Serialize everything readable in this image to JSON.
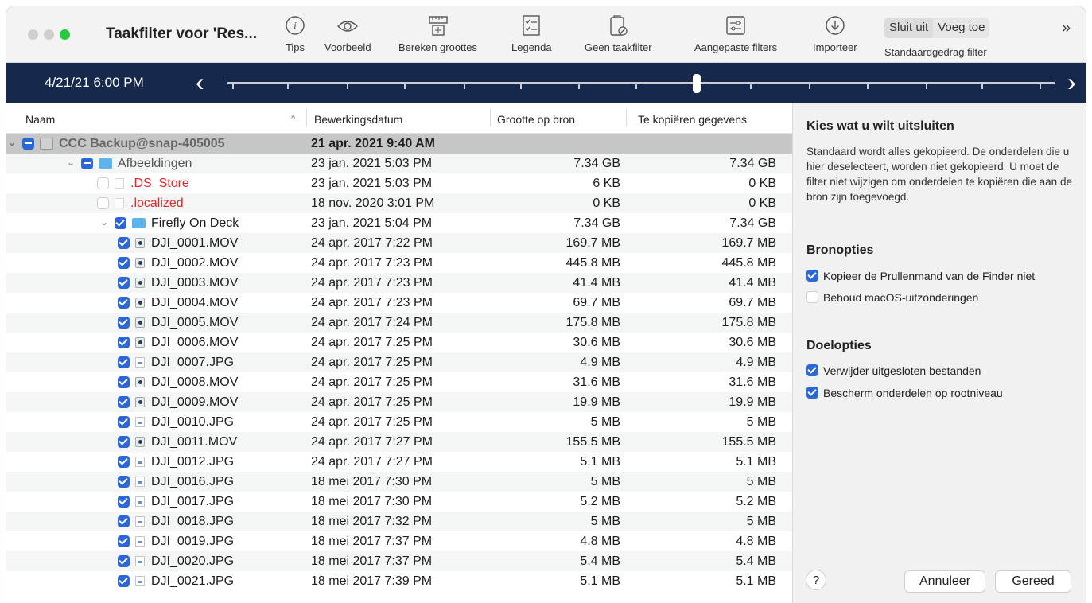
{
  "window": {
    "title": "Taakfilter voor 'Res..."
  },
  "toolbar": {
    "items": [
      {
        "label": "Tips",
        "icon": "info-icon"
      },
      {
        "label": "Voorbeeld",
        "icon": "eye-icon"
      },
      {
        "label": "Bereken groottes",
        "icon": "ruler-icon"
      },
      {
        "label": "Legenda",
        "icon": "checklist-icon"
      },
      {
        "label": "Geen taakfilter",
        "icon": "no-filter-icon"
      },
      {
        "label": "Aangepaste filters",
        "icon": "sliders-icon"
      },
      {
        "label": "Importeer",
        "icon": "download-icon"
      }
    ],
    "segment": {
      "left": "Sluit uit",
      "right": "Voeg toe",
      "selected": "Sluit uit"
    },
    "segment_label": "Standaardgedrag filter",
    "overflow": "»"
  },
  "timeline": {
    "date": "4/21/21 6:00 PM",
    "prev": "‹",
    "next": "›"
  },
  "table": {
    "headers": {
      "name": "Naam",
      "sort": "^",
      "date": "Bewerkingsdatum",
      "size": "Grootte op bron",
      "copy": "Te kopiëren gegevens"
    },
    "rows": [
      {
        "name": "CCC Backup@snap-405005",
        "date": "21 apr. 2021 9:40 AM",
        "size": "",
        "copy": ""
      },
      {
        "name": "Afbeeldingen",
        "date": "23 jan. 2021 5:03 PM",
        "size": "7.34 GB",
        "copy": "7.34 GB"
      },
      {
        "name": ".DS_Store",
        "date": "23 jan. 2021 5:03 PM",
        "size": "6 KB",
        "copy": "0 KB"
      },
      {
        "name": ".localized",
        "date": "18 nov. 2020 3:01 PM",
        "size": "0 KB",
        "copy": "0 KB"
      },
      {
        "name": "Firefly On Deck",
        "date": "23 jan. 2021 5:04 PM",
        "size": "7.34 GB",
        "copy": "7.34 GB"
      },
      {
        "name": "DJI_0001.MOV",
        "date": "24 apr. 2017 7:22 PM",
        "size": "169.7 MB",
        "copy": "169.7 MB"
      },
      {
        "name": "DJI_0002.MOV",
        "date": "24 apr. 2017 7:23 PM",
        "size": "445.8 MB",
        "copy": "445.8 MB"
      },
      {
        "name": "DJI_0003.MOV",
        "date": "24 apr. 2017 7:23 PM",
        "size": "41.4 MB",
        "copy": "41.4 MB"
      },
      {
        "name": "DJI_0004.MOV",
        "date": "24 apr. 2017 7:23 PM",
        "size": "69.7 MB",
        "copy": "69.7 MB"
      },
      {
        "name": "DJI_0005.MOV",
        "date": "24 apr. 2017 7:24 PM",
        "size": "175.8 MB",
        "copy": "175.8 MB"
      },
      {
        "name": "DJI_0006.MOV",
        "date": "24 apr. 2017 7:25 PM",
        "size": "30.6 MB",
        "copy": "30.6 MB"
      },
      {
        "name": "DJI_0007.JPG",
        "date": "24 apr. 2017 7:25 PM",
        "size": "4.9 MB",
        "copy": "4.9 MB"
      },
      {
        "name": "DJI_0008.MOV",
        "date": "24 apr. 2017 7:25 PM",
        "size": "31.6 MB",
        "copy": "31.6 MB"
      },
      {
        "name": "DJI_0009.MOV",
        "date": "24 apr. 2017 7:25 PM",
        "size": "19.9 MB",
        "copy": "19.9 MB"
      },
      {
        "name": "DJI_0010.JPG",
        "date": "24 apr. 2017 7:25 PM",
        "size": "5 MB",
        "copy": "5 MB"
      },
      {
        "name": "DJI_0011.MOV",
        "date": "24 apr. 2017 7:27 PM",
        "size": "155.5 MB",
        "copy": "155.5 MB"
      },
      {
        "name": "DJI_0012.JPG",
        "date": "24 apr. 2017 7:27 PM",
        "size": "5.1 MB",
        "copy": "5.1 MB"
      },
      {
        "name": "DJI_0016.JPG",
        "date": "18 mei 2017 7:30 PM",
        "size": "5 MB",
        "copy": "5 MB"
      },
      {
        "name": "DJI_0017.JPG",
        "date": "18 mei 2017 7:30 PM",
        "size": "5.2 MB",
        "copy": "5.2 MB"
      },
      {
        "name": "DJI_0018.JPG",
        "date": "18 mei 2017 7:32 PM",
        "size": "5 MB",
        "copy": "5 MB"
      },
      {
        "name": "DJI_0019.JPG",
        "date": "18 mei 2017 7:37 PM",
        "size": "4.8 MB",
        "copy": "4.8 MB"
      },
      {
        "name": "DJI_0020.JPG",
        "date": "18 mei 2017 7:37 PM",
        "size": "5.4 MB",
        "copy": "5.4 MB"
      },
      {
        "name": "DJI_0021.JPG",
        "date": "18 mei 2017 7:39 PM",
        "size": "5.1 MB",
        "copy": "5.1 MB"
      }
    ]
  },
  "panel": {
    "heading": "Kies wat u wilt uitsluiten",
    "description": "Standaard wordt alles gekopieerd. De onderdelen die u hier deselecteert, worden niet gekopieerd. U moet de filter niet wijzigen om onderdelen te kopiëren die aan de bron zijn toegevoegd.",
    "source_heading": "Bronopties",
    "source_options": [
      {
        "label": "Kopieer de Prullenmand van de Finder niet",
        "checked": true
      },
      {
        "label": "Behoud macOS-uitzonderingen",
        "checked": false
      }
    ],
    "dest_heading": "Doelopties",
    "dest_options": [
      {
        "label": "Verwijder uitgesloten bestanden",
        "checked": true
      },
      {
        "label": "Bescherm onderdelen op rootniveau",
        "checked": true
      }
    ],
    "help": "?",
    "cancel": "Annuleer",
    "done": "Gereed"
  },
  "colors": {
    "accent": "#2b67d6",
    "timeline": "#16294d",
    "excluded": "#e0262b",
    "folder": "#5fb3ec"
  }
}
